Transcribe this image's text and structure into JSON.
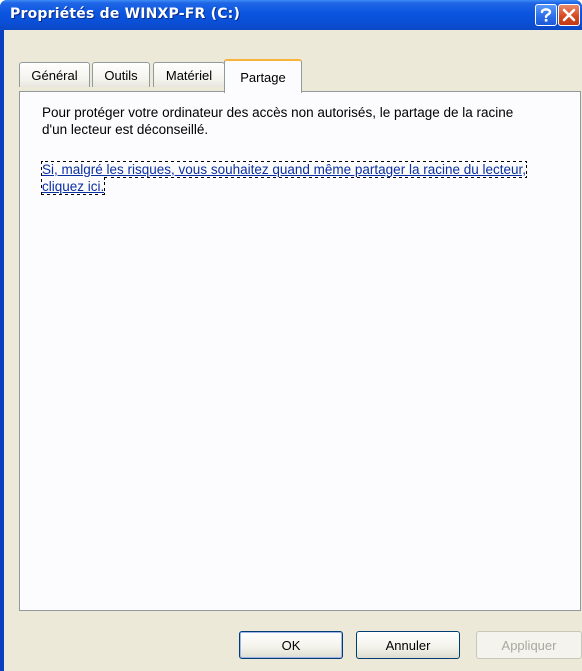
{
  "window": {
    "title": "Propriétés de WINXP-FR (C:)",
    "title_color": "#ffffff",
    "titlebar_color": "#0a55e0"
  },
  "titlebar_buttons": {
    "help_icon": "question-mark-icon",
    "close_icon": "close-x-icon"
  },
  "tabs": [
    {
      "label": "Général",
      "active": false
    },
    {
      "label": "Outils",
      "active": false
    },
    {
      "label": "Matériel",
      "active": false
    },
    {
      "label": "Partage",
      "active": true
    }
  ],
  "panel": {
    "description": "Pour protéger votre ordinateur des accès non autorisés, le partage de la racine d'un lecteur est déconseillé.",
    "link_text": "Si, malgré les risques, vous souhaitez quand même partager la racine du lecteur, cliquez ici.",
    "link_color": "#0a2fa0"
  },
  "buttons": {
    "ok": "OK",
    "cancel": "Annuler",
    "apply": "Appliquer",
    "apply_enabled": false
  }
}
